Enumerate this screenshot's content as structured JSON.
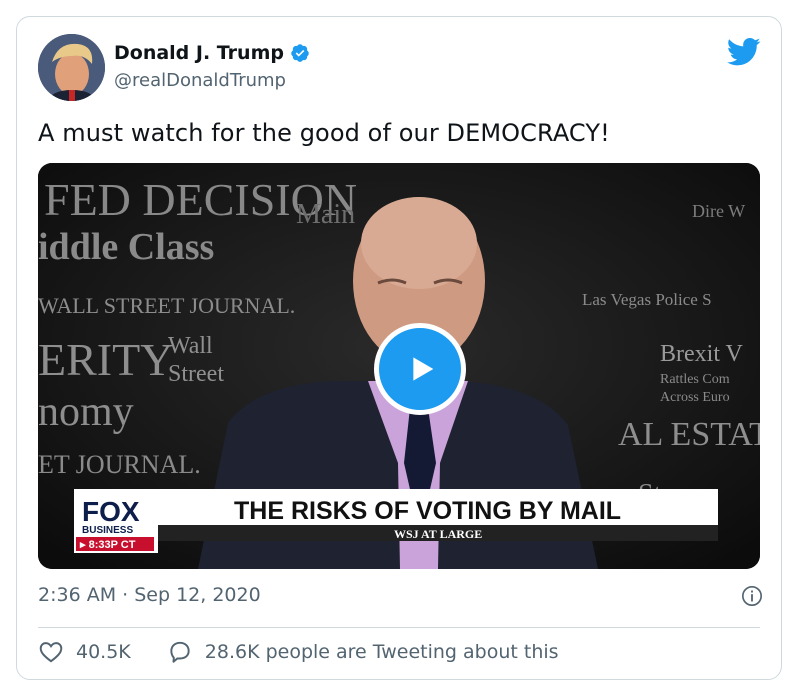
{
  "user": {
    "display_name": "Donald J. Trump",
    "handle": "@realDonaldTrump",
    "verified": true
  },
  "tweet": {
    "text": "A must watch for the good of our DEMOCRACY!",
    "timestamp": "2:36 AM · Sep 12, 2020"
  },
  "video": {
    "backdrop": [
      {
        "text": "FED DECISION"
      },
      {
        "text": "iddle Class"
      },
      {
        "text": "WALL STREET JOURNAL."
      },
      {
        "text": "ERITY"
      },
      {
        "text": "Wall"
      },
      {
        "text": "Street"
      },
      {
        "text": "nomy"
      },
      {
        "text": "ET JOURNAL."
      },
      {
        "text": "Main"
      },
      {
        "text": "Dire W"
      },
      {
        "text": "Las Vegas Police S"
      },
      {
        "text": "Brexit V"
      },
      {
        "text": "Rattles Com"
      },
      {
        "text": "Across Euro"
      },
      {
        "text": "AL ESTAT"
      },
      {
        "text": "Stree"
      }
    ],
    "network_logo": "FOX",
    "network_sub": "BUSINESS",
    "time": "▸ 8:33P CT",
    "headline": "THE RISKS OF VOTING BY MAIL",
    "show": "WSJ AT LARGE"
  },
  "stats": {
    "likes": "40.5K",
    "tweeting": "28.6K people are Tweeting about this"
  },
  "colors": {
    "accent": "#1d9bf0",
    "secondary_text": "#536471",
    "border": "#cfd9de"
  },
  "icons": [
    "twitter-bird-icon",
    "verified-badge-icon",
    "play-icon",
    "info-icon",
    "heart-icon",
    "reply-icon"
  ]
}
